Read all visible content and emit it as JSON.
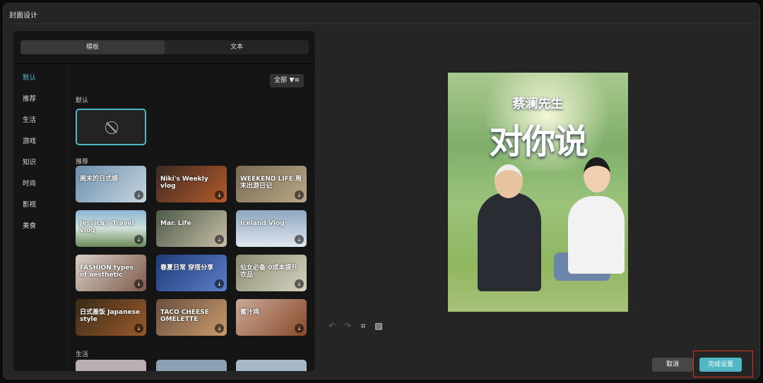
{
  "dialog": {
    "title": "封面设计"
  },
  "tabs": [
    {
      "label": "模板",
      "active": true
    },
    {
      "label": "文本",
      "active": false
    }
  ],
  "categories": [
    "默认",
    "推荐",
    "生活",
    "游戏",
    "知识",
    "时尚",
    "影视",
    "美食"
  ],
  "active_category": "默认",
  "filter": {
    "label": "全部",
    "icon": "filter-icon"
  },
  "sections": {
    "default": "默认",
    "recommended": "推荐",
    "life": "生活"
  },
  "templates": [
    {
      "text": "周末的日式感"
    },
    {
      "text": "Niki's Weekly vlog"
    },
    {
      "text": "WEEKEND LIFE 周末出游日记"
    },
    {
      "text": "Jessica's Travel vlog"
    },
    {
      "text": "Mar. Life"
    },
    {
      "text": "Iceland Vlog"
    },
    {
      "text": "FASHION types of aesthetic"
    },
    {
      "text": "春夏日常 穿搭分享"
    },
    {
      "text": "仙女必备 0成本提升衣品"
    },
    {
      "text": "日式盖饭 Japanese style"
    },
    {
      "text": "TACO CHEESE OMELETTE"
    },
    {
      "text": "蜜汁鸡"
    }
  ],
  "preview": {
    "subtitle": "蔡澜先生",
    "title": "对你说"
  },
  "toolbar": [
    "undo-icon",
    "redo-icon",
    "crop-icon",
    "replace-image-icon"
  ],
  "buttons": {
    "cancel": "取消",
    "confirm": "完成设置"
  },
  "colors": {
    "accent": "#4fb8c4",
    "highlight": "#e0321f"
  }
}
